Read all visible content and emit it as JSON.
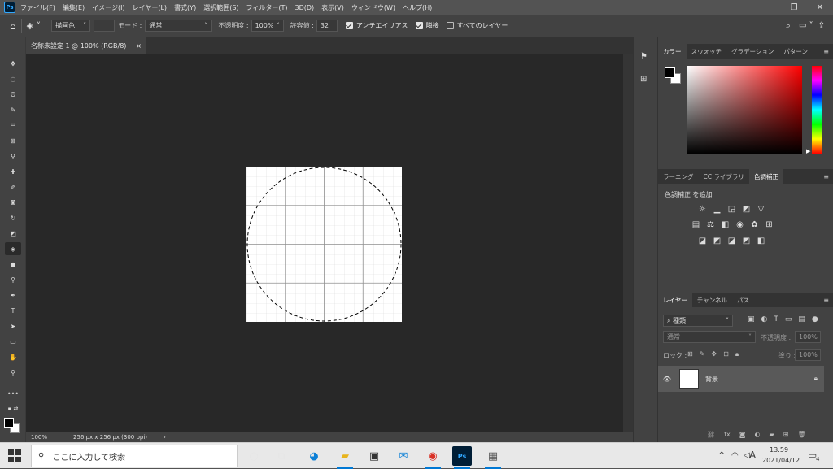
{
  "menubar": {
    "app_icon": "Ps",
    "items": [
      "ファイル(F)",
      "編集(E)",
      "イメージ(I)",
      "レイヤー(L)",
      "書式(Y)",
      "選択範囲(S)",
      "フィルター(T)",
      "3D(D)",
      "表示(V)",
      "ウィンドウ(W)",
      "ヘルプ(H)"
    ]
  },
  "options": {
    "fill_source": "描画色",
    "mode_label": "モード :",
    "mode_value": "通常",
    "opacity_label": "不透明度 :",
    "opacity_value": "100%",
    "tolerance_label": "許容値 :",
    "tolerance_value": "32",
    "antialias_label": "アンチエイリアス",
    "contiguous_label": "隣接",
    "all_layers_label": "すべてのレイヤー"
  },
  "document": {
    "tab_title": "名称未設定 1 @ 100% (RGB/8)",
    "zoom": "100%",
    "doc_info": "256 px x 256 px (300 ppi)"
  },
  "color_panel": {
    "tabs": [
      "カラー",
      "スウォッチ",
      "グラデーション",
      "パターン"
    ],
    "fg_color": "#000000",
    "bg_color": "#ffffff",
    "hue_base": "#ff0000"
  },
  "adjust_panel": {
    "tabs": [
      "ラーニング",
      "CC ライブラリ",
      "色調補正"
    ],
    "title": "色調補正 を追加"
  },
  "layers_panel": {
    "tabs": [
      "レイヤー",
      "チャンネル",
      "パス"
    ],
    "search_placeholder": "種類",
    "blend_mode": "通常",
    "opacity_label": "不透明度 :",
    "opacity_value": "100%",
    "lock_label": "ロック :",
    "fill_label": "塗り :",
    "fill_value": "100%",
    "layer_name": "背景"
  },
  "taskbar": {
    "search_placeholder": "ここに入力して検索",
    "ime": "A",
    "time": "13:59",
    "date": "2021/04/12",
    "notifications": "4"
  }
}
